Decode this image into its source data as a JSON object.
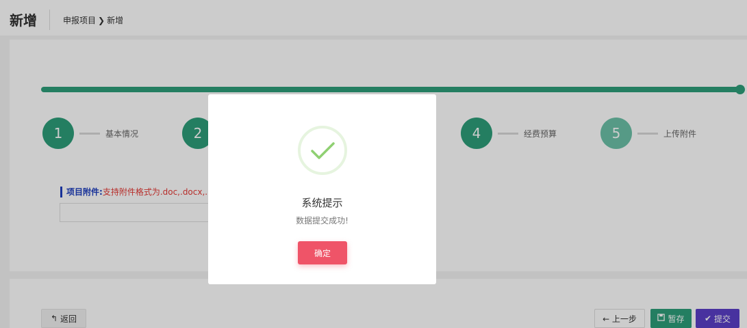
{
  "header": {
    "title": "新增",
    "breadcrumb": {
      "parent": "申报项目",
      "separator": "❯",
      "current": "新增"
    }
  },
  "steps": [
    {
      "number": "1",
      "label": "基本情况"
    },
    {
      "number": "2",
      "label": ""
    },
    {
      "number": "4",
      "label": "经费预算"
    },
    {
      "number": "5",
      "label": "上传附件"
    }
  ],
  "attachment": {
    "label": "项目附件:",
    "hint": "支持附件格式为.doc,.docx,.pdf"
  },
  "buttons": {
    "back": "返回",
    "prev": "← 上一步",
    "save": "暂存",
    "submit": "提交"
  },
  "modal": {
    "title": "系统提示",
    "message": "数据提交成功!",
    "confirm": "确定"
  },
  "colors": {
    "primary": "#2e9e7a",
    "danger": "#ef5468",
    "submit": "#5b3fc7",
    "hint": "#e53935"
  }
}
